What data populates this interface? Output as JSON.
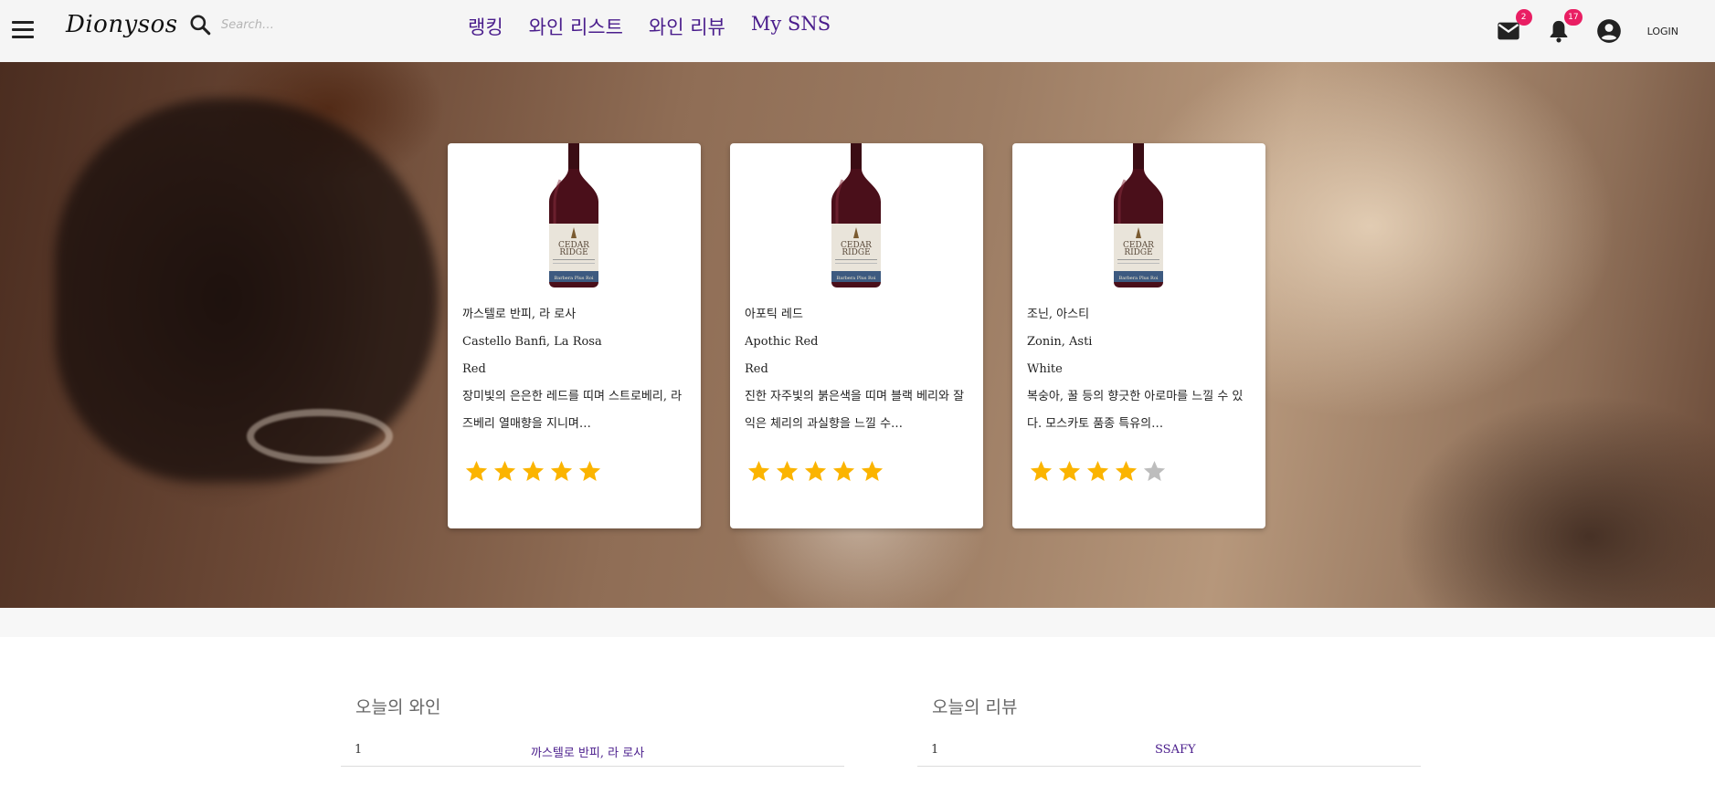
{
  "header": {
    "logo": "Dionysos",
    "search_placeholder": "Search…",
    "nav": [
      "랭킹",
      "와인 리스트",
      "와인 리뷰",
      "My SNS"
    ],
    "mail_badge": "2",
    "notification_badge": "17",
    "login_label": "LOGIN",
    "icons": [
      "menu-icon",
      "search-icon",
      "mail-icon",
      "bell-icon",
      "account-circle-icon"
    ]
  },
  "hero": {
    "cards": [
      {
        "name_ko": "까스텔로 반피, 라 로사",
        "name_en": "Castello Banfi, La Rosa",
        "type": "Red",
        "description": "장미빛의 은은한 레드를 띠며 스트로베리, 라즈베리 열매향을 지니며…",
        "rating": 5
      },
      {
        "name_ko": "아포틱 레드",
        "name_en": "Apothic Red",
        "type": "Red",
        "description": "진한 자주빛의 붉은색을 띠며 블랙 베리와 잘 익은 체리의 과실향을 느낄 수…",
        "rating": 5
      },
      {
        "name_ko": "조닌, 아스티",
        "name_en": "Zonin, Asti",
        "type": "White",
        "description": "복숭아, 꿀 등의 향긋한 아로마를 느낄 수 있다. 모스카토 품종 특유의…",
        "rating": 4
      }
    ],
    "bottle_label": {
      "brand_line1": "CEDAR",
      "brand_line2": "RIDGE",
      "variety": "Barbera Plus Roi"
    },
    "star_colors": {
      "filled": "#fbb400",
      "empty": "#bdbdbd"
    }
  },
  "today_wine": {
    "title": "오늘의 와인",
    "rows": [
      {
        "rank": "1",
        "name": "까스텔로 반피, 라 로사"
      }
    ]
  },
  "today_review": {
    "title": "오늘의 리뷰",
    "rows": [
      {
        "rank": "1",
        "name": "SSAFY"
      }
    ]
  },
  "colors": {
    "accent": "#4a1d8c",
    "badge": "#e91e63",
    "appbar": "#f5f5f5"
  }
}
